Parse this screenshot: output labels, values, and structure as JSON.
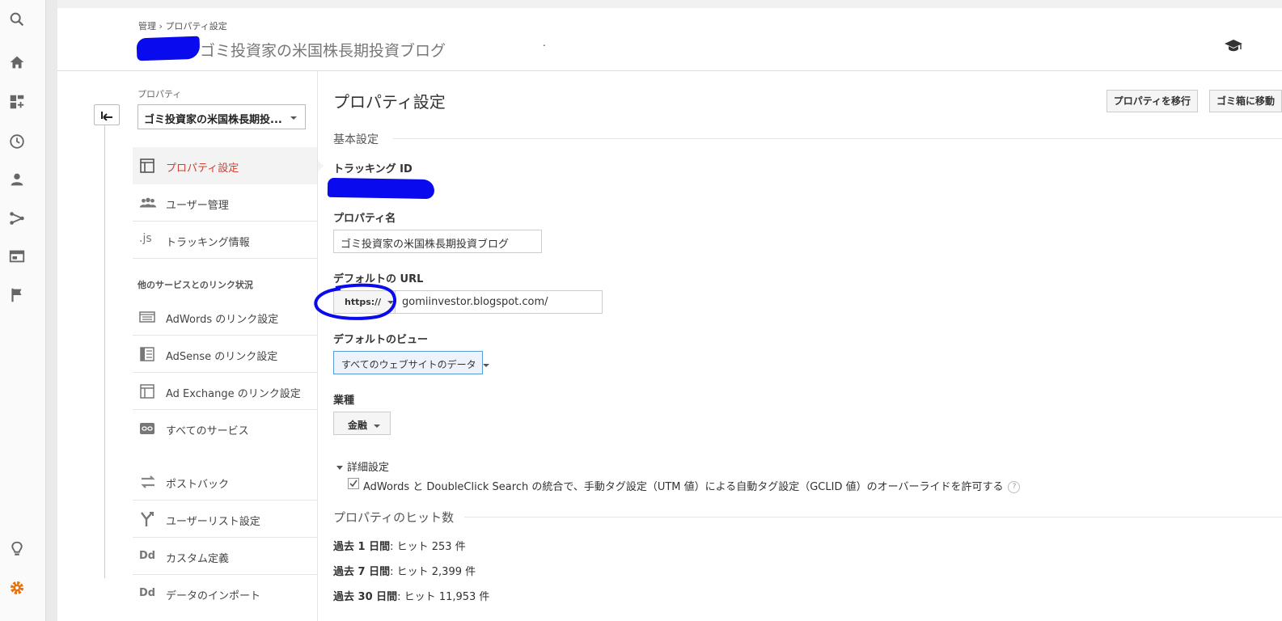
{
  "colors": {
    "accent_red": "#d23f31",
    "active_orange": "#e8710a",
    "scribble_blue": "#0a0aee"
  },
  "icons": [
    "search-icon",
    "home-icon",
    "customization-icon",
    "clock-icon",
    "person-icon",
    "acquisition-icon",
    "behavior-icon",
    "flag-icon",
    "lightbulb-icon",
    "gear-icon",
    "graduation-cap-icon",
    "back-arrow-icon"
  ],
  "header": {
    "breadcrumb_admin": "管理",
    "breadcrumb_sep": "›",
    "breadcrumb_current": "プロパティ設定",
    "title": "ゴミ投資家の米国株長期投資ブログ",
    "dot": "."
  },
  "left_nav": {
    "property_label": "プロパティ",
    "property_select": "ゴミ投資家の米国株長期投...",
    "items": [
      {
        "label": "プロパティ設定",
        "icon": "layout-icon"
      },
      {
        "label": "ユーザー管理",
        "icon": "group-icon"
      },
      {
        "label": "トラッキング情報",
        "icon": "js-icon",
        "icon_text": ".js"
      }
    ],
    "section_title": "他のサービスとのリンク状況",
    "link_items": [
      {
        "label": "AdWords のリンク設定",
        "icon": "adwords-icon"
      },
      {
        "label": "AdSense のリンク設定",
        "icon": "adsense-icon"
      },
      {
        "label": "Ad Exchange のリンク設定",
        "icon": "adexchange-icon"
      },
      {
        "label": "すべてのサービス",
        "icon": "link-icon"
      }
    ],
    "other_items": [
      {
        "label": "ポストバック",
        "icon": "postback-icon"
      },
      {
        "label": "ユーザーリスト設定",
        "icon": "fork-icon"
      },
      {
        "label": "カスタム定義",
        "icon": "dd-icon",
        "icon_text": "Dd"
      },
      {
        "label": "データのインポート",
        "icon": "dd-icon",
        "icon_text": "Dd"
      }
    ]
  },
  "content": {
    "title": "プロパティ設定",
    "move_button": "プロパティを移行",
    "trash_button": "ゴミ箱に移動",
    "basic_settings": "基本設定",
    "tracking_id_label": "トラッキング ID",
    "property_name_label": "プロパティ名",
    "property_name_value": "ゴミ投資家の米国株長期投資ブログ",
    "default_url_label": "デフォルトの URL",
    "url_protocol": "https://",
    "url_value": "gomiinvestor.blogspot.com/",
    "default_view_label": "デフォルトのビュー",
    "default_view_value": "すべてのウェブサイトのデータ",
    "industry_label": "業種",
    "industry_value": "金融",
    "advanced_label": "詳細設定",
    "advanced_checkbox": "AdWords と DoubleClick Search の統合で、手動タグ設定（UTM 値）による自動タグ設定（GCLID 値）のオーバーライドを許可する",
    "help_mark": "?",
    "hits_title": "プロパティのヒット数",
    "hits": [
      {
        "period": "過去 1 日間",
        "text": ": ヒット",
        "value": "253 件"
      },
      {
        "period": "過去 7 日間",
        "text": ": ヒット",
        "value": "2,399 件"
      },
      {
        "period": "過去 30 日間",
        "text": ": ヒット",
        "value": "11,953 件"
      }
    ]
  }
}
